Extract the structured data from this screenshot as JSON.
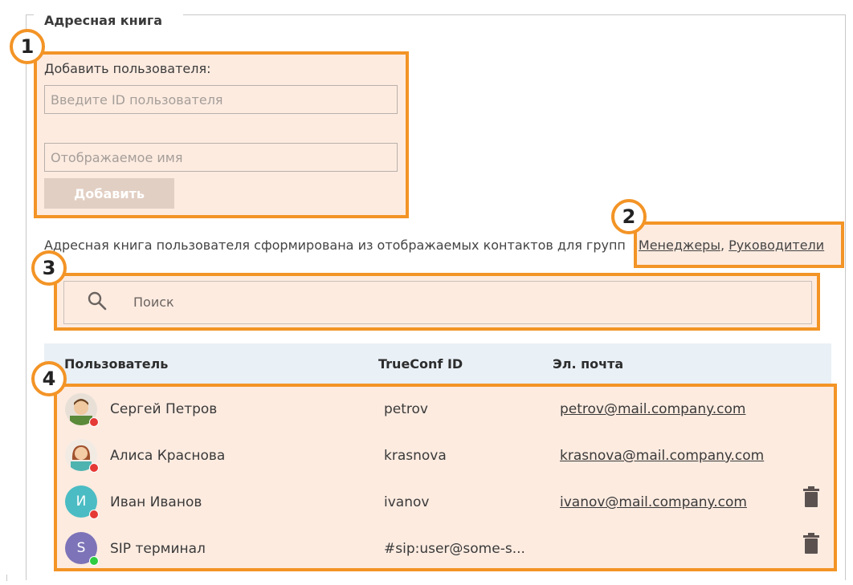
{
  "section": {
    "title": "Адресная книга"
  },
  "badges": [
    "1",
    "2",
    "3",
    "4"
  ],
  "add_user": {
    "label": "Добавить пользователя:",
    "id_placeholder": "Введите ID пользователя",
    "name_placeholder": "Отображаемое имя",
    "button_label": "Добавить"
  },
  "description": {
    "text": "Адресная книга пользователя сформирована из отображаемых контактов для групп",
    "groups": [
      "Менеджеры",
      "Руководители"
    ],
    "separator": ","
  },
  "search": {
    "placeholder": "Поиск",
    "icon": "search-icon"
  },
  "table": {
    "columns": [
      "Пользователь",
      "TrueConf ID",
      "Эл. почта"
    ],
    "rows": [
      {
        "name": "Сергей Петров",
        "id": "petrov",
        "email": "petrov@mail.company.com",
        "avatar_type": "photo-man",
        "status": "offline",
        "deletable": false
      },
      {
        "name": "Алиса Краснова",
        "id": "krasnova",
        "email": "krasnova@mail.company.com",
        "avatar_type": "photo-woman",
        "status": "offline",
        "deletable": false
      },
      {
        "name": "Иван Иванов",
        "id": "ivanov",
        "email": "ivanov@mail.company.com",
        "avatar_type": "letter",
        "avatar_letter": "И",
        "status": "offline",
        "deletable": true
      },
      {
        "name": "SIP терминал",
        "id": "#sip:user@some-s...",
        "email": "",
        "avatar_type": "letter",
        "avatar_letter": "S",
        "status": "online",
        "deletable": true
      }
    ]
  },
  "colors": {
    "highlight_border": "#f39426",
    "highlight_fill": "#fdebe0",
    "status_offline": "#e53935",
    "status_online": "#2ecc40",
    "avatar_ivanov": "#4bbcc3",
    "avatar_sip": "#7c73b8"
  }
}
